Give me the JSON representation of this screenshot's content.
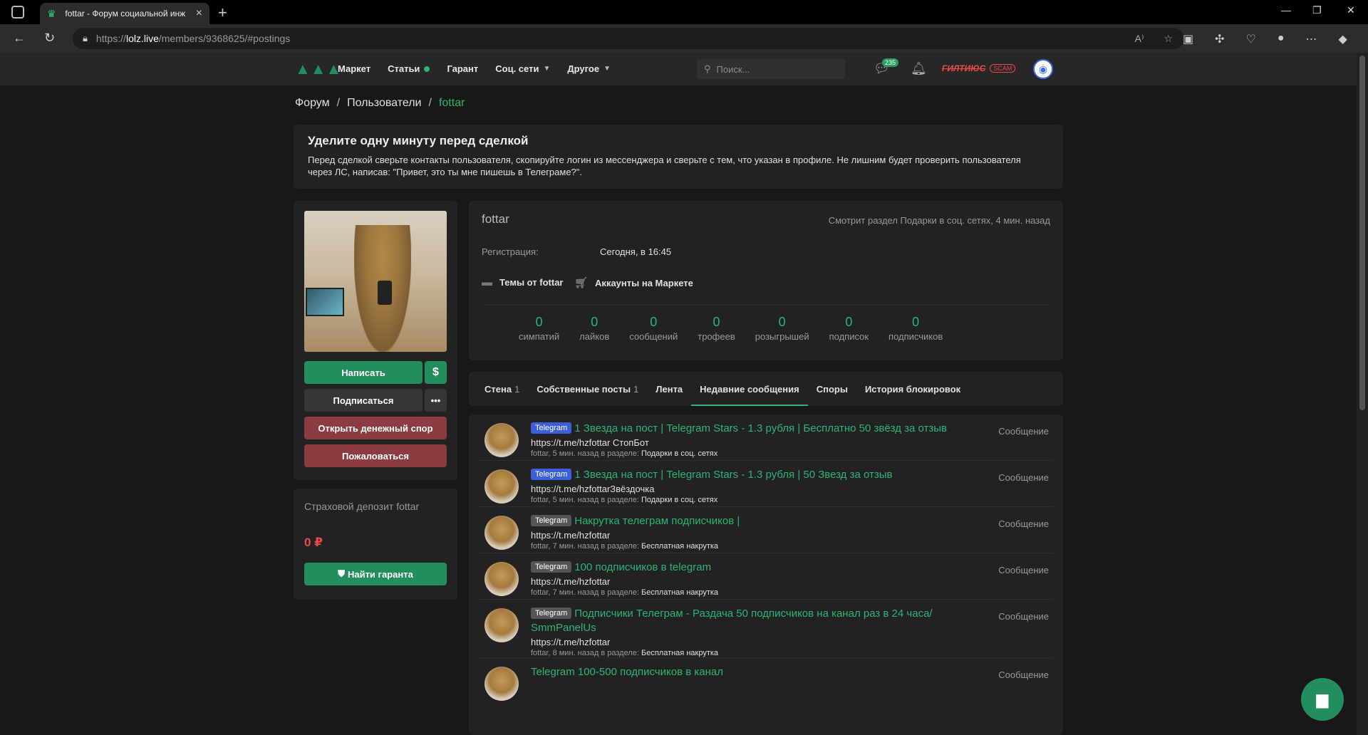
{
  "browser": {
    "tab_title": "fottar - Форум социальной инж",
    "url_prefix": "https://",
    "url_host": "lolz.live",
    "url_path": "/members/9368625/#postings"
  },
  "header": {
    "menu": [
      "Маркет",
      "Статьи",
      "Гарант",
      "Соц. сети",
      "Другое"
    ],
    "search_placeholder": "Поиск...",
    "chat_badge": "235",
    "username": "ГИЛТИЮС",
    "scam_label": "SCAM"
  },
  "breadcrumb": [
    "Форум",
    "Пользователи",
    "fottar"
  ],
  "notice": {
    "title": "Уделите одну минуту перед сделкой",
    "text": "Перед сделкой сверьте контакты пользователя, скопируйте логин из мессенджера и сверьте с тем, что указан в профиле. Не лишним будет проверить пользователя через ЛС, написав: \"Привет, это ты мне пишешь в Телеграме?\"."
  },
  "sidebar": {
    "write_label": "Написать",
    "dollar_label": "$",
    "subscribe_label": "Подписаться",
    "more_label": "•••",
    "dispute_label": "Открыть денежный спор",
    "report_label": "Пожаловаться",
    "deposit_title": "Страховой депозит fottar",
    "deposit_amount": "0 ₽",
    "guarantor_label": "Найти гаранта"
  },
  "profile": {
    "name": "fottar",
    "status": "Смотрит раздел Подарки в соц. сетях, 4 мин. назад",
    "reg_label": "Регистрация:",
    "reg_value": "Сегодня, в 16:45",
    "link_topics": "Темы от fottar",
    "link_market": "Аккаунты на Маркете",
    "counters": [
      {
        "num": "0",
        "label": "симпатий"
      },
      {
        "num": "0",
        "label": "лайков"
      },
      {
        "num": "0",
        "label": "сообщений"
      },
      {
        "num": "0",
        "label": "трофеев"
      },
      {
        "num": "0",
        "label": "розыгрышей"
      },
      {
        "num": "0",
        "label": "подписок"
      },
      {
        "num": "0",
        "label": "подписчиков"
      }
    ]
  },
  "tabs": [
    {
      "label": "Стена",
      "count": "1"
    },
    {
      "label": "Собственные посты",
      "count": "1"
    },
    {
      "label": "Лента",
      "count": ""
    },
    {
      "label": "Недавние сообщения",
      "count": ""
    },
    {
      "label": "Споры",
      "count": ""
    },
    {
      "label": "История блокировок",
      "count": ""
    }
  ],
  "posts": [
    {
      "prefix": "Telegram",
      "title": "1 Звезда на пост | Telegram Stars - 1.3 рубля | Бесплатно 50 звёзд за отзыв",
      "snippet": "https://t.me/hzfottar СтопБот",
      "meta": "fottar, 5 мин. назад в разделе:",
      "section": "Подарки в соц. сетях",
      "type": "Сообщение"
    },
    {
      "prefix": "Telegram",
      "title": "1 Звезда на пост | Telegram Stars - 1.3 рубля | 50 Звезд за отзыв",
      "snippet": "https://t.me/hzfottarЗвёздочка",
      "meta": "fottar, 5 мин. назад в разделе:",
      "section": "Подарки в соц. сетях",
      "type": "Сообщение"
    },
    {
      "prefix": "Telegram",
      "title": "Накрутка телеграм подписчиков |",
      "snippet": "https://t.me/hzfottar",
      "meta": "fottar, 7 мин. назад в разделе:",
      "section": "Бесплатная накрутка",
      "type": "Сообщение"
    },
    {
      "prefix": "Telegram",
      "title": "100 подписчиков в telegram",
      "snippet": "https://t.me/hzfottar",
      "meta": "fottar, 7 мин. назад в разделе:",
      "section": "Бесплатная накрутка",
      "type": "Сообщение"
    },
    {
      "prefix": "Telegram",
      "title": "Подписчики Телеграм - Раздача 50 подписчиков на канал раз в 24 часа/ SmmPanelUs",
      "snippet": "https://t.me/hzfottar",
      "meta": "fottar, 8 мин. назад в разделе:",
      "section": "Бесплатная накрутка",
      "type": "Сообщение"
    },
    {
      "prefix": "",
      "title": "Telegram 100-500 подписчиков в канал",
      "snippet": "",
      "meta": "",
      "section": "",
      "type": "Сообщение"
    }
  ]
}
